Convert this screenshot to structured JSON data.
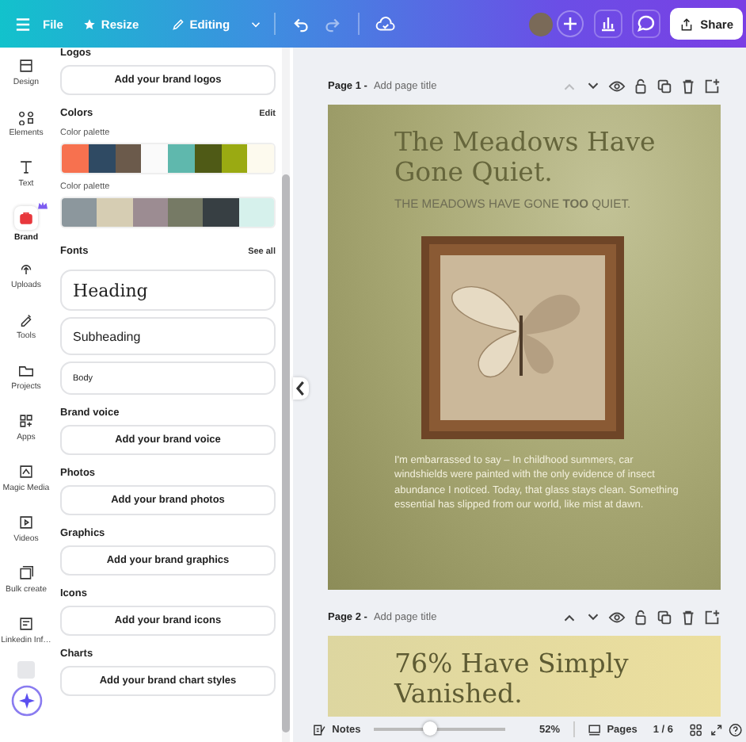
{
  "topbar": {
    "file": "File",
    "resize": "Resize",
    "mode": "Editing",
    "share": "Share"
  },
  "rail": [
    {
      "label": "Design",
      "selected": false
    },
    {
      "label": "Elements",
      "selected": false
    },
    {
      "label": "Text",
      "selected": false
    },
    {
      "label": "Brand",
      "selected": true
    },
    {
      "label": "Uploads",
      "selected": false
    },
    {
      "label": "Tools",
      "selected": false
    },
    {
      "label": "Projects",
      "selected": false
    },
    {
      "label": "Apps",
      "selected": false
    },
    {
      "label": "Magic Media",
      "selected": false
    },
    {
      "label": "Videos",
      "selected": false
    },
    {
      "label": "Bulk create",
      "selected": false
    },
    {
      "label": "Linkedin Inf…",
      "selected": false
    }
  ],
  "panel": [
    {
      "kind": "button",
      "heading": "Logos",
      "button": "Add your brand logos"
    },
    {
      "kind": "colors",
      "heading": "Colors",
      "action": "Edit",
      "palettes": [
        {
          "label": "Color palette",
          "swatches": [
            {
              "color": "#f7714f"
            },
            {
              "color": "#2f4a63"
            },
            {
              "color": "#6b5a4b"
            },
            {
              "color": "#fafafa"
            },
            {
              "color": "#5fb8ad"
            },
            {
              "color": "#4f5a16"
            },
            {
              "color": "#9aaa12"
            },
            {
              "color": "#fdfaee"
            }
          ]
        },
        {
          "label": "Color palette",
          "swatches": [
            {
              "color": "#8c979d"
            },
            {
              "color": "#d6cdb3"
            },
            {
              "color": "#9c8c92"
            },
            {
              "color": "#767a65"
            },
            {
              "color": "#373f43"
            },
            {
              "color": "#d6f1ec"
            }
          ]
        }
      ]
    },
    {
      "kind": "fonts",
      "heading": "Fonts",
      "action": "See all",
      "fonts": [
        "Heading",
        "Subheading",
        "Body"
      ]
    },
    {
      "kind": "button",
      "heading": "Brand voice",
      "button": "Add your brand voice"
    },
    {
      "kind": "button",
      "heading": "Photos",
      "button": "Add your brand photos"
    },
    {
      "kind": "button",
      "heading": "Graphics",
      "button": "Add your brand graphics"
    },
    {
      "kind": "button",
      "heading": "Icons",
      "button": "Add your brand icons"
    },
    {
      "kind": "button",
      "heading": "Charts",
      "button": "Add your brand chart styles"
    }
  ],
  "pages": [
    {
      "label": "Page 1 -",
      "title_placeholder": "Add page title",
      "up_disabled": true,
      "title": "The Meadows Have Gone Quiet.",
      "subtitle": "THE MEADOWS HAVE GONE **TOO** QUIET.",
      "body": "I'm embarrassed to say – In childhood summers, car windshields were painted with the only evidence of insect abundance I noticed. Today, that glass stays clean. Something essential has slipped from our world, like mist at dawn."
    },
    {
      "label": "Page 2 -",
      "title_placeholder": "Add page title",
      "up_disabled": false,
      "title": "76% Have Simply Vanished."
    }
  ],
  "footer": {
    "notes": "Notes",
    "zoom": {
      "level": 0.42
    },
    "zoom_reading": "52%",
    "pages": "Pages",
    "page_count": "1 / 6"
  }
}
